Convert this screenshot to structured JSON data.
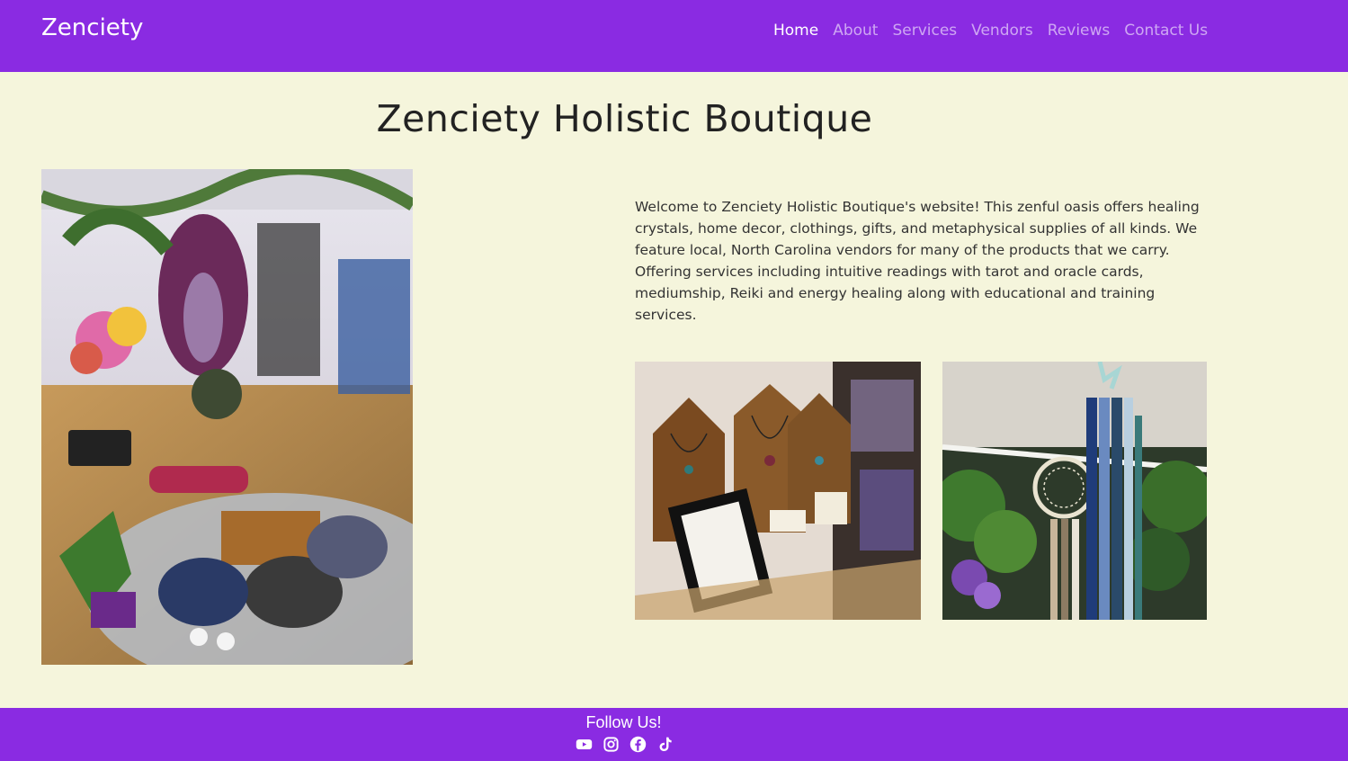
{
  "brand": "Zenciety",
  "nav": {
    "items": [
      {
        "label": "Home",
        "active": true
      },
      {
        "label": "About",
        "active": false
      },
      {
        "label": "Services",
        "active": false
      },
      {
        "label": "Vendors",
        "active": false
      },
      {
        "label": "Reviews",
        "active": false
      },
      {
        "label": "Contact Us",
        "active": false
      }
    ]
  },
  "main": {
    "title": "Zenciety Holistic Boutique",
    "intro": "Welcome to Zenciety Holistic Boutique's website! This zenful oasis offers healing crystals, home decor, clothings, gifts, and metaphysical supplies of all kinds. We feature local, North Carolina vendors for many of the products that we carry. Offering services including intuitive readings with tarot and oracle cards, mediumship, Reiki and energy healing along with educational and training services."
  },
  "footer": {
    "follow_label": "Follow Us!",
    "socials": [
      "youtube-icon",
      "instagram-icon",
      "facebook-icon",
      "tiktok-icon"
    ]
  },
  "colors": {
    "primary": "#8a2be2",
    "background": "#f5f5dc",
    "text": "#222222"
  }
}
